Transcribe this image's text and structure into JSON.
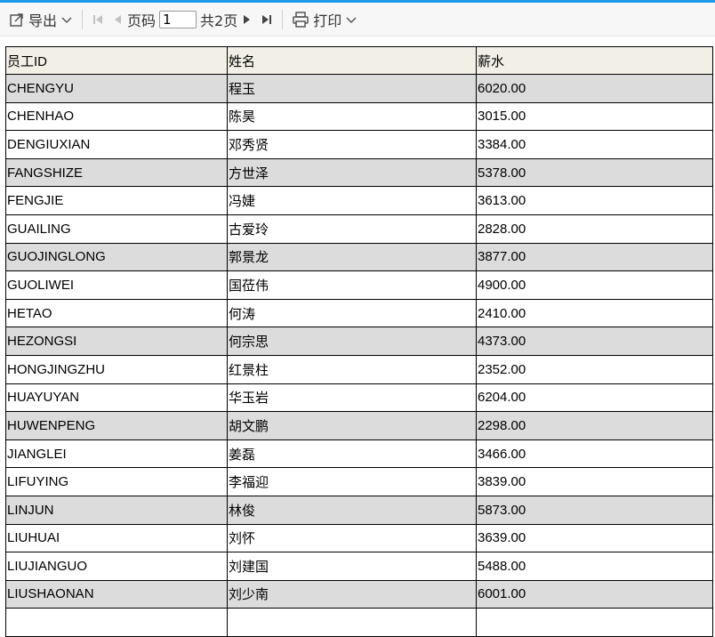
{
  "toolbar": {
    "export_label": "导出",
    "page_label": "页码",
    "page_value": "1",
    "total_pages_label": "共2页",
    "print_label": "打印"
  },
  "icons": {
    "export": "export-icon",
    "dropdown": "chevron-down-icon",
    "first": "first-page-icon",
    "prev": "prev-page-icon",
    "next": "next-page-icon",
    "last": "last-page-icon",
    "print": "print-icon"
  },
  "colors": {
    "accent": "#1e9be8",
    "header_bg": "#f2f0e6",
    "shaded_row": "#dcdcdc"
  },
  "table": {
    "headers": [
      "员工ID",
      "姓名",
      "薪水"
    ],
    "rows": [
      {
        "id": "CHENGYU",
        "name": "程玉",
        "salary": "6020.00",
        "shaded": true
      },
      {
        "id": "CHENHAO",
        "name": "陈昊",
        "salary": "3015.00",
        "shaded": false
      },
      {
        "id": "DENGIUXIAN",
        "name": "邓秀贤",
        "salary": "3384.00",
        "shaded": false
      },
      {
        "id": "FANGSHIZE",
        "name": "方世泽",
        "salary": "5378.00",
        "shaded": true
      },
      {
        "id": "FENGJIE",
        "name": "冯婕",
        "salary": "3613.00",
        "shaded": false
      },
      {
        "id": "GUAILING",
        "name": "古爱玲",
        "salary": "2828.00",
        "shaded": false
      },
      {
        "id": "GUOJINGLONG",
        "name": "郭景龙",
        "salary": "3877.00",
        "shaded": true
      },
      {
        "id": "GUOLIWEI",
        "name": "国莅伟",
        "salary": "4900.00",
        "shaded": false
      },
      {
        "id": "HETAO",
        "name": "何涛",
        "salary": "2410.00",
        "shaded": false
      },
      {
        "id": "HEZONGSI",
        "name": "何宗思",
        "salary": "4373.00",
        "shaded": true
      },
      {
        "id": "HONGJINGZHU",
        "name": "红景柱",
        "salary": "2352.00",
        "shaded": false
      },
      {
        "id": "HUAYUYAN",
        "name": "华玉岩",
        "salary": "6204.00",
        "shaded": false
      },
      {
        "id": "HUWENPENG",
        "name": "胡文鹏",
        "salary": "2298.00",
        "shaded": true
      },
      {
        "id": "JIANGLEI",
        "name": "姜磊",
        "salary": "3466.00",
        "shaded": false
      },
      {
        "id": "LIFUYING",
        "name": "李福迎",
        "salary": "3839.00",
        "shaded": false
      },
      {
        "id": "LINJUN",
        "name": "林俊",
        "salary": "5873.00",
        "shaded": true
      },
      {
        "id": "LIUHUAI",
        "name": "刘怀",
        "salary": "3639.00",
        "shaded": false
      },
      {
        "id": "LIUJIANGUO",
        "name": "刘建国",
        "salary": "5488.00",
        "shaded": false
      },
      {
        "id": "LIUSHAONAN",
        "name": "刘少南",
        "salary": "6001.00",
        "shaded": true
      },
      {
        "id": "",
        "name": "",
        "salary": "",
        "shaded": false
      }
    ]
  }
}
